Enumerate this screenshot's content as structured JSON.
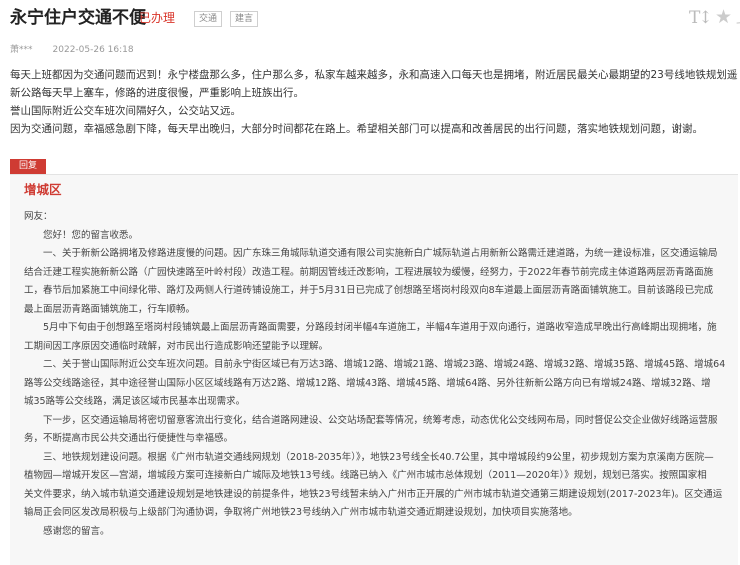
{
  "header": {
    "title": "永宁住户交通不便",
    "status": "已办理",
    "tags": [
      "交通",
      "建言"
    ],
    "font_size_glyph": "T↕"
  },
  "meta": {
    "author": "萧***",
    "date": "2022-05-26 16:18"
  },
  "post": {
    "lines": [
      "每天上班都因为交通问题而迟到！永宁楼盘那么多，住户那么多，私家车越来越多，永和高速入口每天也是拥堵，附近居民最关心最期望的23号线地铁规划遥遥无期，新",
      "新公路每天早上塞车，修路的进度很慢，严重影响上班族出行。",
      "誉山国际附近公交车班次间隔好久，公交站又远。",
      "因为交通问题，幸福感急剧下降，每天早出晚归，大部分时间都花在路上。希望相关部门可以提高和改善居民的出行问题，落实地铁规划问题，谢谢。"
    ]
  },
  "reply": {
    "badge": "回复",
    "department": "增城区",
    "lines": [
      "网友：",
      "　　您好！您的留言收悉。",
      "　　一、关于新新公路拥堵及修路进度慢的问题。因广东珠三角城际轨道交通有限公司实施新白广城际轨道占用新新公路需迁建道路，为统一建设标准，区交通运输局",
      "结合迁建工程实施新新公路（广园快速路至叶岭村段）改造工程。前期因管线迁改影响，工程进展较为缓慢，经努力，于2022年春节前完成主体道路两层沥青路面施",
      "工，春节后加紧施工中间绿化带、路灯及两侧人行道砖铺设施工，并于5月31日已完成了创想路至塔岗村段双向8车道最上面层沥青路面铺筑施工。目前该路段已完成",
      "最上面层沥青路面铺筑施工，行车顺畅。",
      "　　5月中下旬由于创想路至塔岗村段铺筑最上面层沥青路面需要，分路段封闭半幅4车道施工，半幅4车道用于双向通行，道路收窄造成早晚出行高峰期出现拥堵，施",
      "工期间因工序原因交通临时疏解，对市民出行造成影响还望能予以理解。",
      "　　二、关于誉山国际附近公交车班次问题。目前永宁街区域已有万达3路、增城12路、增城21路、增城23路、增城24路、增城32路、增城35路、增城45路、增城64",
      "路等公交线路途径，其中途径誉山国际小区区域线路有万达2路、增城12路、增城43路、增城45路、增城64路、另外往新新公路方向已有增城24路、增城32路、增",
      "城35路等公交线路，满足该区域市民基本出现需求。",
      "　　下一步，区交通运输局将密切留意客流出行变化，结合道路网建设、公交站场配套等情况，统筹考虑，动态优化公交线网布局，同时督促公交企业做好线路运营服",
      "务，不断提高市民公共交通出行便捷性与幸福感。",
      "　　三、地铁规划建设问题。根据《广州市轨道交通线网规划（2018-2035年）》，地铁23号线全长40.7公里，其中增城段约9公里，初步规划方案为京溪南方医院—",
      "植物园—增城开发区—宫湖，增城段方案可连接新白广城际及地铁13号线。线路已纳入《广州市城市总体规划（2011—2020年）》规划，规划已落实。按照国家相",
      "关文件要求，纳入城市轨道交通建设规划是地铁建设的前提条件，地铁23号线暂未纳入广州市正开展的广州市城市轨道交通第三期建设规划(2017-2023年)。区交通运",
      "输局正会同区发改局积极与上级部门沟通协调，争取将广州地铁23号线纳入广州市城市轨道交通近期建设规划，加快项目实施落地。",
      "　　感谢您的留言。"
    ]
  },
  "colors": {
    "accent": "#cf3b33",
    "reply_bg": "#f7f7f7",
    "text": "#333333",
    "muted": "#999999"
  },
  "icons": [
    "font-size-icon",
    "star-icon",
    "share-icon"
  ]
}
